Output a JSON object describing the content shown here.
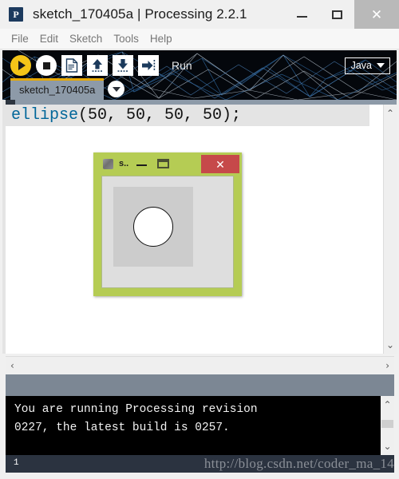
{
  "window": {
    "app_icon": "P",
    "title": "sketch_170405a | Processing 2.2.1",
    "minimize_label": "minimize",
    "maximize_label": "maximize",
    "close_label": "✕"
  },
  "menubar": {
    "items": [
      {
        "label": "File"
      },
      {
        "label": "Edit"
      },
      {
        "label": "Sketch"
      },
      {
        "label": "Tools"
      },
      {
        "label": "Help"
      }
    ]
  },
  "toolbar": {
    "run_button": "run-icon",
    "stop_button": "stop-icon",
    "new_button": "new-file-icon",
    "open_button": "open-up-arrow-icon",
    "save_button": "save-down-arrow-icon",
    "export_button": "export-right-arrow-icon",
    "run_label": "Run",
    "mode_label": "Java",
    "accent_yellow": "#f5c518",
    "background": "#04070c"
  },
  "tabs": {
    "active_tab": "sketch_170405a",
    "tab_accent": "#e7a800",
    "menu_icon": "chevron-down-icon"
  },
  "editor": {
    "code": {
      "function_name": "ellipse",
      "arguments": "(50, 50, 50, 50);"
    },
    "function_color": "#006699",
    "scroll_up_icon": "⌃",
    "scroll_down_icon": "⌄",
    "scroll_left_icon": "‹",
    "scroll_right_icon": "›"
  },
  "sketch_window": {
    "title": "s..",
    "app_icon": "sketch-app-icon",
    "minimize_label": "minimize",
    "maximize_label": "maximize",
    "close_label": "✕",
    "frame_color": "#b5cc54",
    "close_color": "#c6494a",
    "canvas_color": "#cccccc",
    "shape": "ellipse",
    "shape_fill": "#ffffff",
    "shape_stroke": "#101010"
  },
  "console": {
    "message": "You are running Processing revision\n0227, the latest build is 0257.",
    "scroll_up_icon": "⌃",
    "scroll_down_icon": "⌄"
  },
  "statusbar": {
    "line_number": "1",
    "watermark": "http://blog.csdn.net/coder_ma_14"
  }
}
